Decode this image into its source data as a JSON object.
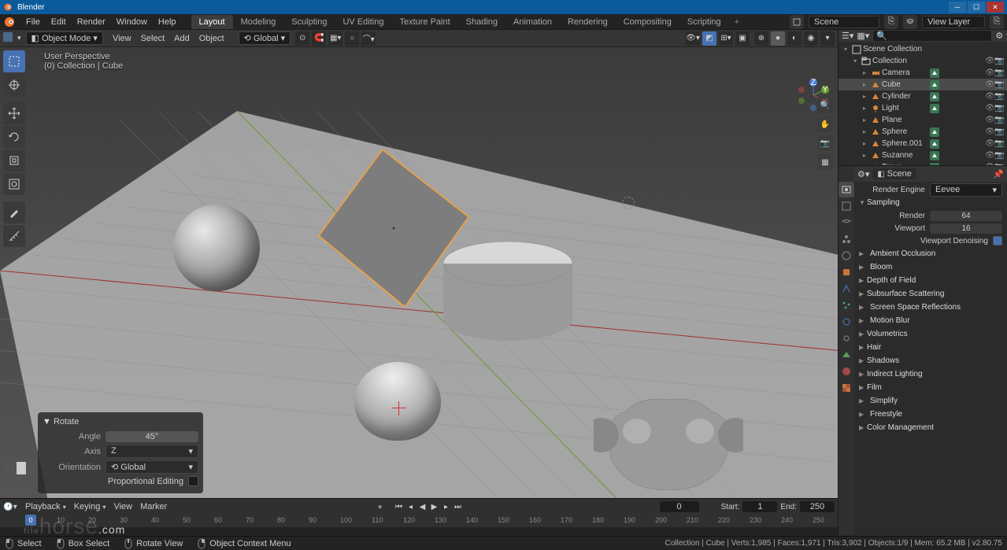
{
  "app": {
    "title": "Blender"
  },
  "topmenu": {
    "items": [
      "File",
      "Edit",
      "Render",
      "Window",
      "Help"
    ],
    "workspaces": [
      "Layout",
      "Modeling",
      "Sculpting",
      "UV Editing",
      "Texture Paint",
      "Shading",
      "Animation",
      "Rendering",
      "Compositing",
      "Scripting"
    ],
    "active_workspace": 0,
    "scene_label": "Scene",
    "viewlayer_label": "View Layer"
  },
  "header3d": {
    "mode": "Object Mode",
    "menus": [
      "View",
      "Select",
      "Add",
      "Object"
    ],
    "orientation": "Global"
  },
  "viewport": {
    "info_line1": "User Perspective",
    "info_line2": "(0) Collection | Cube"
  },
  "operator": {
    "title": "Rotate",
    "angle_label": "Angle",
    "angle": "45°",
    "axis_label": "Axis",
    "axis": "Z",
    "orientation_label": "Orientation",
    "orientation": "Global",
    "proportional_label": "Proportional Editing"
  },
  "timeline": {
    "menus": [
      "Playback",
      "Keying",
      "View",
      "Marker"
    ],
    "current": "0",
    "start_label": "Start:",
    "start": "1",
    "end_label": "End:",
    "end": "250",
    "ticks": [
      "0",
      "10",
      "20",
      "30",
      "40",
      "50",
      "60",
      "70",
      "80",
      "90",
      "100",
      "110",
      "120",
      "130",
      "140",
      "150",
      "160",
      "170",
      "180",
      "190",
      "200",
      "210",
      "220",
      "230",
      "240",
      "250"
    ]
  },
  "outliner": {
    "root": "Scene Collection",
    "collection": "Collection",
    "items": [
      {
        "name": "Camera",
        "type": "camera",
        "selected": false,
        "badge": true
      },
      {
        "name": "Cube",
        "type": "mesh",
        "selected": true,
        "badge": true
      },
      {
        "name": "Cylinder",
        "type": "mesh",
        "selected": false,
        "badge": true
      },
      {
        "name": "Light",
        "type": "light",
        "selected": false,
        "badge": true
      },
      {
        "name": "Plane",
        "type": "mesh",
        "selected": false,
        "badge": false
      },
      {
        "name": "Sphere",
        "type": "mesh",
        "selected": false,
        "badge": true
      },
      {
        "name": "Sphere.001",
        "type": "mesh",
        "selected": false,
        "badge": true
      },
      {
        "name": "Suzanne",
        "type": "mesh",
        "selected": false,
        "badge": true
      },
      {
        "name": "Torus",
        "type": "mesh",
        "selected": false,
        "badge": true
      }
    ]
  },
  "properties": {
    "context": "Scene",
    "render_engine_label": "Render Engine",
    "render_engine": "Eevee",
    "sampling": {
      "title": "Sampling",
      "render_label": "Render",
      "render": "64",
      "viewport_label": "Viewport",
      "viewport": "16",
      "denoise_label": "Viewport Denoising",
      "denoise_checked": true
    },
    "sections": [
      {
        "name": "Ambient Occlusion",
        "open": false,
        "check": true
      },
      {
        "name": "Bloom",
        "open": false,
        "check": true
      },
      {
        "name": "Depth of Field",
        "open": false,
        "check": false
      },
      {
        "name": "Subsurface Scattering",
        "open": false,
        "check": false
      },
      {
        "name": "Screen Space Reflections",
        "open": false,
        "check": true
      },
      {
        "name": "Motion Blur",
        "open": false,
        "check": true
      },
      {
        "name": "Volumetrics",
        "open": false,
        "check": false
      },
      {
        "name": "Hair",
        "open": false,
        "check": false
      },
      {
        "name": "Shadows",
        "open": false,
        "check": false
      },
      {
        "name": "Indirect Lighting",
        "open": false,
        "check": false
      },
      {
        "name": "Film",
        "open": false,
        "check": false
      },
      {
        "name": "Simplify",
        "open": false,
        "check": true
      },
      {
        "name": "Freestyle",
        "open": false,
        "check": true
      },
      {
        "name": "Color Management",
        "open": false,
        "check": false
      }
    ]
  },
  "statusbar": {
    "items": [
      {
        "icon": "mouse-left",
        "label": "Select"
      },
      {
        "icon": "mouse-left",
        "label": "Box Select"
      },
      {
        "icon": "mouse-middle",
        "label": "Rotate View"
      },
      {
        "icon": "mouse-right",
        "label": "Object Context Menu"
      }
    ],
    "right": "Collection | Cube | Verts:1,985 | Faces:1,971 | Tris:3,902 | Objects:1/9 | Mem: 65.2 MB | v2.80.75"
  },
  "watermark": "filehorse.com"
}
